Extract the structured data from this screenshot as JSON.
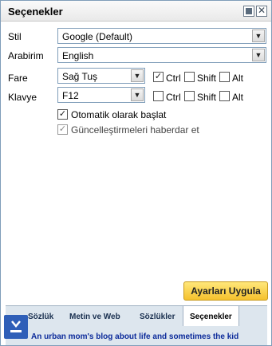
{
  "window": {
    "title": "Seçenekler"
  },
  "fields": {
    "stil": {
      "label": "Stil",
      "value": "Google (Default)"
    },
    "arabirim": {
      "label": "Arabirim",
      "value": "English"
    },
    "fare": {
      "label": "Fare",
      "value": "Sağ Tuş",
      "ctrl": true,
      "shift": false,
      "alt": false
    },
    "klavye": {
      "label": "Klavye",
      "value": "F12",
      "ctrl": false,
      "shift": false,
      "alt": false
    }
  },
  "modifiers": {
    "ctrl": "Ctrl",
    "shift": "Shift",
    "alt": "Alt"
  },
  "options": {
    "autostart": {
      "label": "Otomatik olarak başlat",
      "checked": true
    },
    "updates": {
      "label": "Güncelleştirmeleri haberdar et",
      "checked": true,
      "disabled": true
    }
  },
  "apply_label": "Ayarları Uygula",
  "tabs": [
    {
      "label": "Sözlük"
    },
    {
      "label": "Metin ve Web"
    },
    {
      "label": "Sözlükler"
    },
    {
      "label": "Seçenekler",
      "active": true
    }
  ],
  "footer_text": "An urban mom's blog about life and sometimes the kid"
}
